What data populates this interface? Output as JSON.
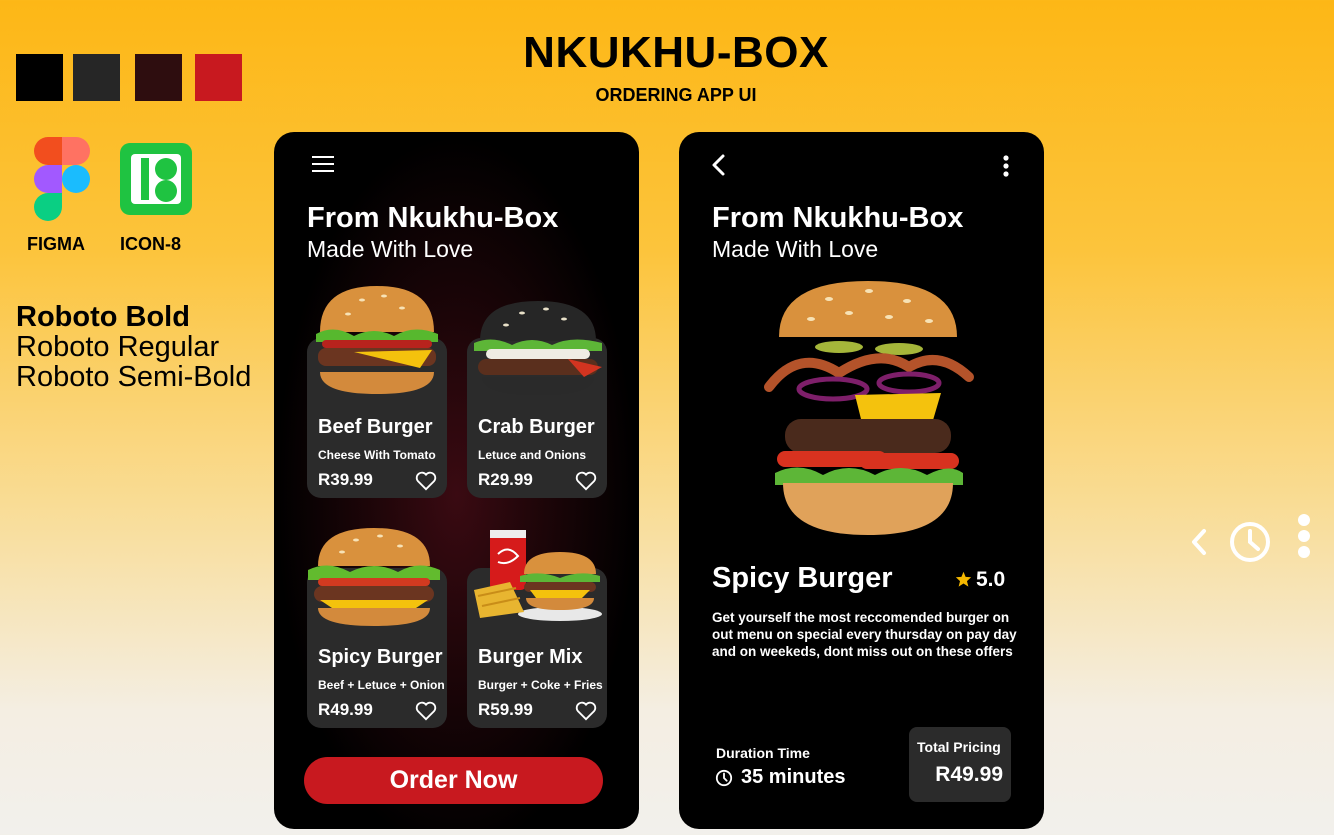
{
  "header": {
    "title": "NKUKHU-BOX",
    "subtitle": "ORDERING APP UI"
  },
  "palette": [
    "#000000",
    "#262626",
    "#2e0d0f",
    "#c8191f"
  ],
  "tools": {
    "figma_label": "FIGMA",
    "icon8_label": "ICON-8"
  },
  "fonts": {
    "bold": "Roboto Bold",
    "regular": "Roboto Regular",
    "semibold": "Roboto Semi-Bold"
  },
  "menu_screen": {
    "title": "From Nkukhu-Box",
    "subtitle": "Made With Love",
    "items": [
      {
        "name": "Beef Burger",
        "desc": "Cheese With Tomato",
        "price": "R39.99"
      },
      {
        "name": "Crab Burger",
        "desc": "Letuce and Onions",
        "price": "R29.99"
      },
      {
        "name": "Spicy Burger",
        "desc": "Beef + Letuce + Onion",
        "price": "R49.99"
      },
      {
        "name": "Burger Mix",
        "desc": "Burger + Coke + Fries",
        "price": "R59.99"
      }
    ],
    "order_button": "Order Now"
  },
  "detail_screen": {
    "title": "From Nkukhu-Box",
    "subtitle": "Made With Love",
    "name": "Spicy Burger",
    "rating": "5.0",
    "description": "Get yourself the most reccomended burger on out menu on special every thursday on pay day and on weekeds, dont miss out on these offers",
    "duration_label": "Duration Time",
    "duration_value": "35 minutes",
    "price_label": "Total Pricing",
    "price_value": "R49.99"
  },
  "icons": [
    "menu-icon",
    "back-icon",
    "more-vertical-icon",
    "heart-icon",
    "star-icon",
    "clock-icon"
  ],
  "colors": {
    "accent": "#c8191f",
    "star": "#f5b800",
    "card": "#2b2b2b"
  }
}
